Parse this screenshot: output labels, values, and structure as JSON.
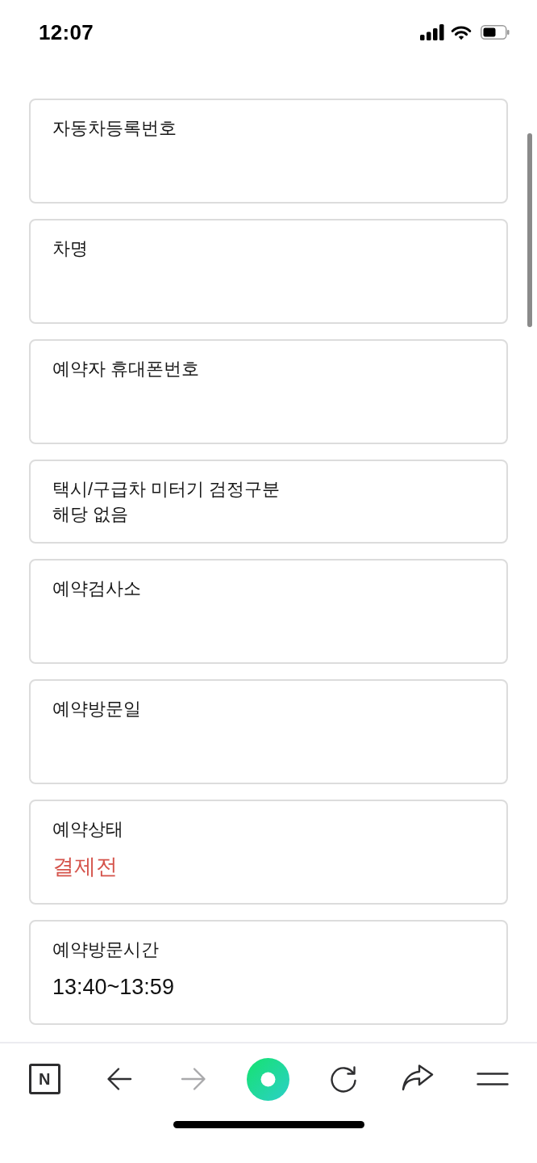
{
  "status_bar": {
    "time": "12:07"
  },
  "fields": [
    {
      "kind": "field",
      "label": "자동차등록번호"
    },
    {
      "kind": "field",
      "label": "차명"
    },
    {
      "kind": "field",
      "label": "예약자 휴대폰번호"
    },
    {
      "kind": "note",
      "label": "택시/구급차 미터기 검정구분",
      "value": "해당 없음"
    },
    {
      "kind": "field",
      "label": "예약검사소"
    },
    {
      "kind": "field",
      "label": "예약방문일"
    },
    {
      "kind": "status",
      "label": "예약상태",
      "value": "결제전"
    },
    {
      "kind": "field",
      "label": "예약방문시간",
      "value": "13:40~13:59"
    }
  ],
  "toolbar": [
    {
      "kind": "home",
      "label": "N",
      "disabled": false
    },
    {
      "kind": "back",
      "disabled": false
    },
    {
      "kind": "forward",
      "disabled": true
    },
    {
      "kind": "ring",
      "disabled": false
    },
    {
      "kind": "reload",
      "disabled": false
    },
    {
      "kind": "share",
      "disabled": false
    },
    {
      "kind": "menu",
      "disabled": false
    }
  ]
}
